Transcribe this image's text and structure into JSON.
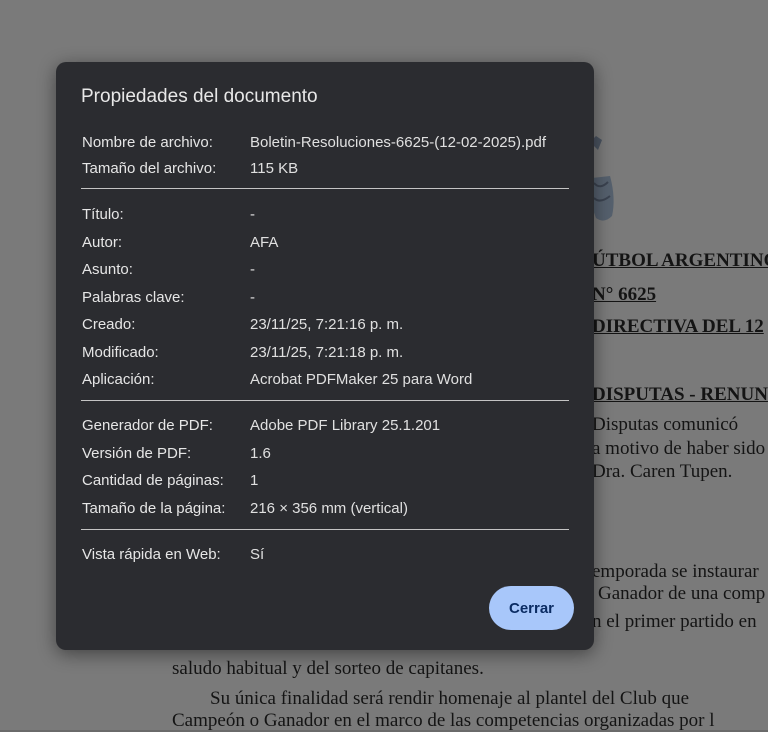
{
  "background_document": {
    "lines": [
      {
        "text": "ÚTBOL ARGENTINO",
        "bold": true
      },
      {
        "text": "N° 6625",
        "bold": true
      },
      {
        "text": "DIRECTIVA DEL 12",
        "bold": true
      },
      {
        "text": "DISPUTAS - RENUN",
        "bold": true
      },
      {
        "text": "Disputas  comunicó"
      },
      {
        "text": "a motivo de haber sido"
      },
      {
        "text": "Dra. Caren Tupen."
      },
      {
        "text": "emporada se instaurar"
      },
      {
        "text": "Ganador de una comp"
      },
      {
        "text": "n el primer partido en"
      },
      {
        "text": "saludo habitual y del sorteo de capitanes."
      },
      {
        "text": "Su única finalidad será rendir homenaje al plantel del Club que"
      },
      {
        "text": "Campeón o Ganador en el marco de las competencias organizadas por l"
      }
    ]
  },
  "dialog": {
    "title": "Propiedades del documento",
    "file_section": [
      {
        "label": "Nombre de archivo:",
        "value": "Boletin-Resoluciones-6625-(12-02-2025).pdf"
      },
      {
        "label": "Tamaño del archivo:",
        "value": "115 KB"
      }
    ],
    "meta_section": [
      {
        "label": "Título:",
        "value": "-"
      },
      {
        "label": "Autor:",
        "value": "AFA"
      },
      {
        "label": "Asunto:",
        "value": "-"
      },
      {
        "label": "Palabras clave:",
        "value": "-"
      },
      {
        "label": "Creado:",
        "value": "23/11/25, 7:21:16 p. m."
      },
      {
        "label": "Modificado:",
        "value": "23/11/25, 7:21:18 p. m."
      },
      {
        "label": "Aplicación:",
        "value": "Acrobat PDFMaker 25 para Word"
      }
    ],
    "pdf_section": [
      {
        "label": "Generador de PDF:",
        "value": "Adobe PDF Library 25.1.201"
      },
      {
        "label": "Versión de PDF:",
        "value": "1.6"
      },
      {
        "label": "Cantidad de páginas:",
        "value": "1"
      },
      {
        "label": "Tamaño de la página:",
        "value": "216 × 356 mm (vertical)"
      }
    ],
    "web_section": [
      {
        "label": "Vista rápida en Web:",
        "value": "Sí"
      }
    ],
    "close_label": "Cerrar"
  },
  "colors": {
    "dialog_bg": "#2b2c30",
    "button_bg": "#a8c7fa",
    "button_text": "#0b2c63"
  }
}
